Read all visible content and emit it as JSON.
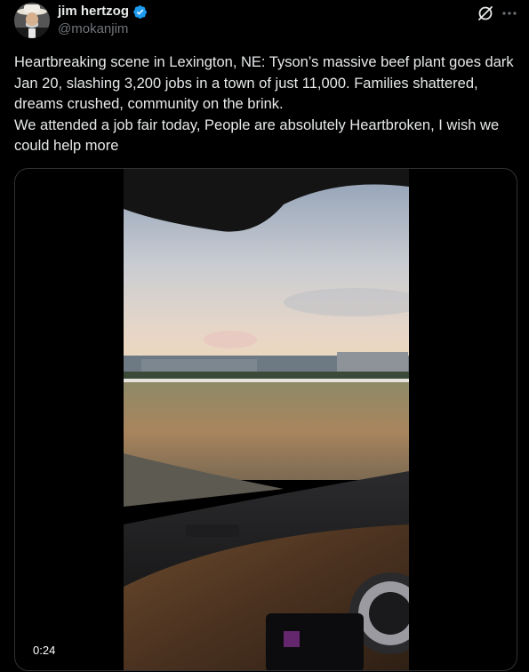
{
  "author": {
    "display_name": "jim hertzog",
    "handle": "@mokanjim",
    "verified": true,
    "verified_color": "#1d9bf0"
  },
  "tweet": {
    "text": "Heartbreaking scene in Lexington, NE: Tyson’s massive beef plant goes dark Jan 20, slashing 3,200 jobs in a town of just 11,000. Families shattered, dreams crushed, community on the brink.\nWe attended a job fair today, People are absolutely Heartbroken, I wish we could help more"
  },
  "media": {
    "type": "video",
    "duration": "0:24"
  },
  "icons": {
    "grok": "grok-icon",
    "more": "more-options-icon",
    "verified": "verified-badge-icon"
  },
  "colors": {
    "background": "#000000",
    "text": "#e7e9ea",
    "secondary_text": "#71767b",
    "border": "#2f3336"
  }
}
